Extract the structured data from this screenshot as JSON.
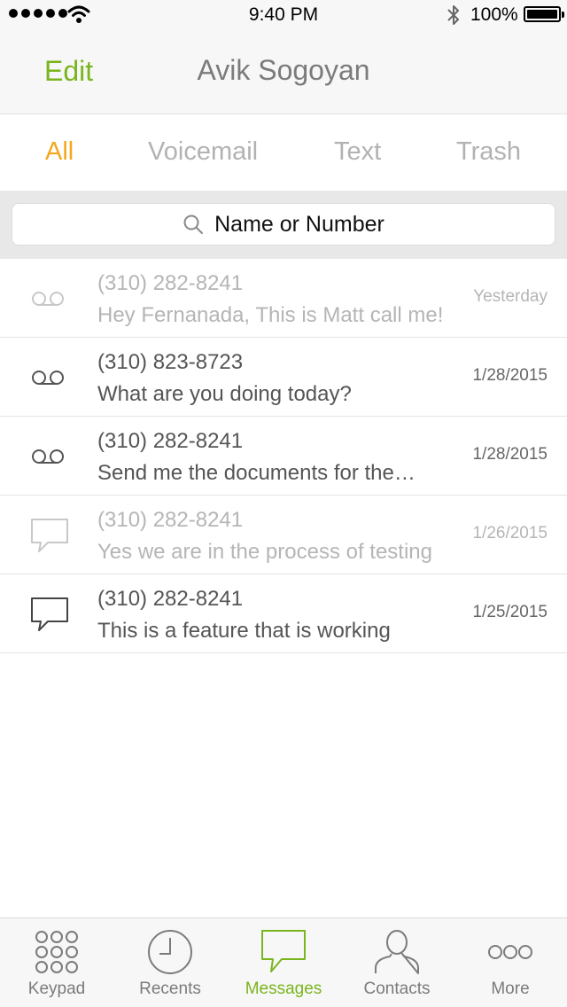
{
  "status_bar": {
    "time": "9:40 PM",
    "battery": "100%"
  },
  "nav": {
    "edit_label": "Edit",
    "title": "Avik Sogoyan"
  },
  "filters": [
    {
      "label": "All",
      "active": true
    },
    {
      "label": "Voicemail",
      "active": false
    },
    {
      "label": "Text",
      "active": false
    },
    {
      "label": "Trash",
      "active": false
    }
  ],
  "search": {
    "placeholder": "Name or Number"
  },
  "messages": [
    {
      "type": "voicemail-icon",
      "number": "(310) 282-8241",
      "preview": "Hey Fernanada,  This is Matt call me!",
      "date": "Yesterday",
      "read": true
    },
    {
      "type": "voicemail-icon",
      "number": "(310) 823-8723",
      "preview": "What are you doing today?",
      "date": "1/28/2015",
      "read": false
    },
    {
      "type": "voicemail-icon",
      "number": "(310) 282-8241",
      "preview": "Send me the documents for the…",
      "date": "1/28/2015",
      "read": false
    },
    {
      "type": "chat-bubble-icon",
      "number": "(310) 282-8241",
      "preview": "Yes we are in the process of testing",
      "date": "1/26/2015",
      "read": true
    },
    {
      "type": "chat-bubble-icon",
      "number": "(310) 282-8241",
      "preview": "This is a feature that is working",
      "date": "1/25/2015",
      "read": false
    }
  ],
  "tabs": [
    {
      "label": "Keypad",
      "icon": "keypad-icon",
      "active": false
    },
    {
      "label": "Recents",
      "icon": "clock-icon",
      "active": false
    },
    {
      "label": "Messages",
      "icon": "message-bubble-icon",
      "active": true
    },
    {
      "label": "Contacts",
      "icon": "person-icon",
      "active": false
    },
    {
      "label": "More",
      "icon": "more-dots-icon",
      "active": false
    }
  ],
  "colors": {
    "accent_green": "#7ab51d",
    "accent_orange": "#f3a81b",
    "muted": "#b5b5b5"
  }
}
